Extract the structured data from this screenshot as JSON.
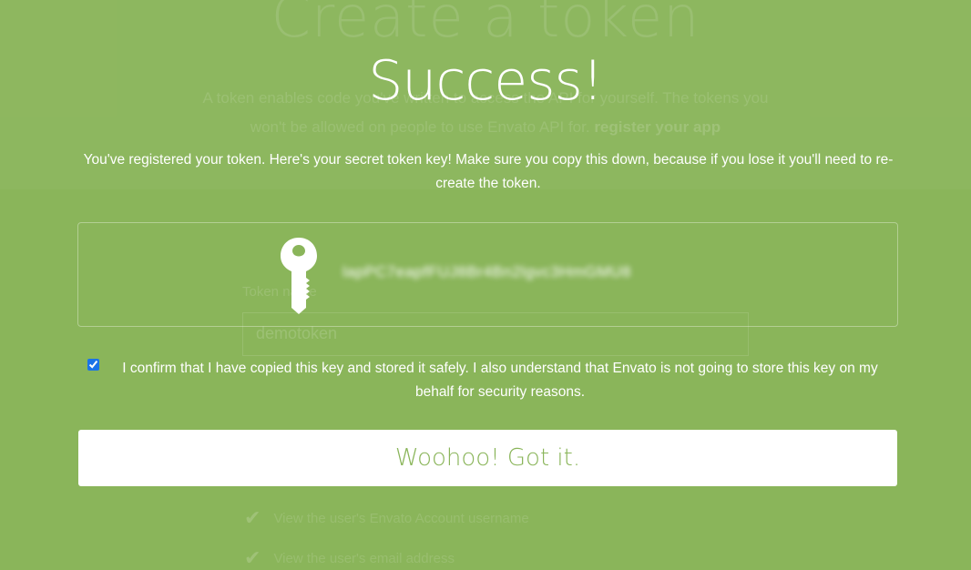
{
  "background": {
    "title": "Create a token",
    "description_lines": [
      "A token enables code you've written to access the API for yourself. The tokens you",
      "won't be allowed on people to use Envato API for."
    ],
    "description_link": "register your app",
    "name_label": "Token name",
    "name_value": "demotoken",
    "permissions": [
      "View the user's Envato Account username",
      "View the user's email address"
    ]
  },
  "modal": {
    "title": "Success!",
    "message": "You've registered your token. Here's your secret token key! Make sure you copy this down, because if you lose it you'll need to re-create the token.",
    "key_icon": "key-icon",
    "token_key": "lapPC7eapfFUJ8Br4Bn2lgvc3HmGMU8",
    "confirm_text": "I confirm that I have copied this key and stored it safely. I also understand that Envato is not going to store this key on my behalf for security reasons.",
    "confirm_checked": true,
    "button_label": "Woohoo! Got it."
  },
  "colors": {
    "background": "#8ab55a",
    "button_text": "#8ab55a",
    "button_bg": "#ffffff"
  }
}
